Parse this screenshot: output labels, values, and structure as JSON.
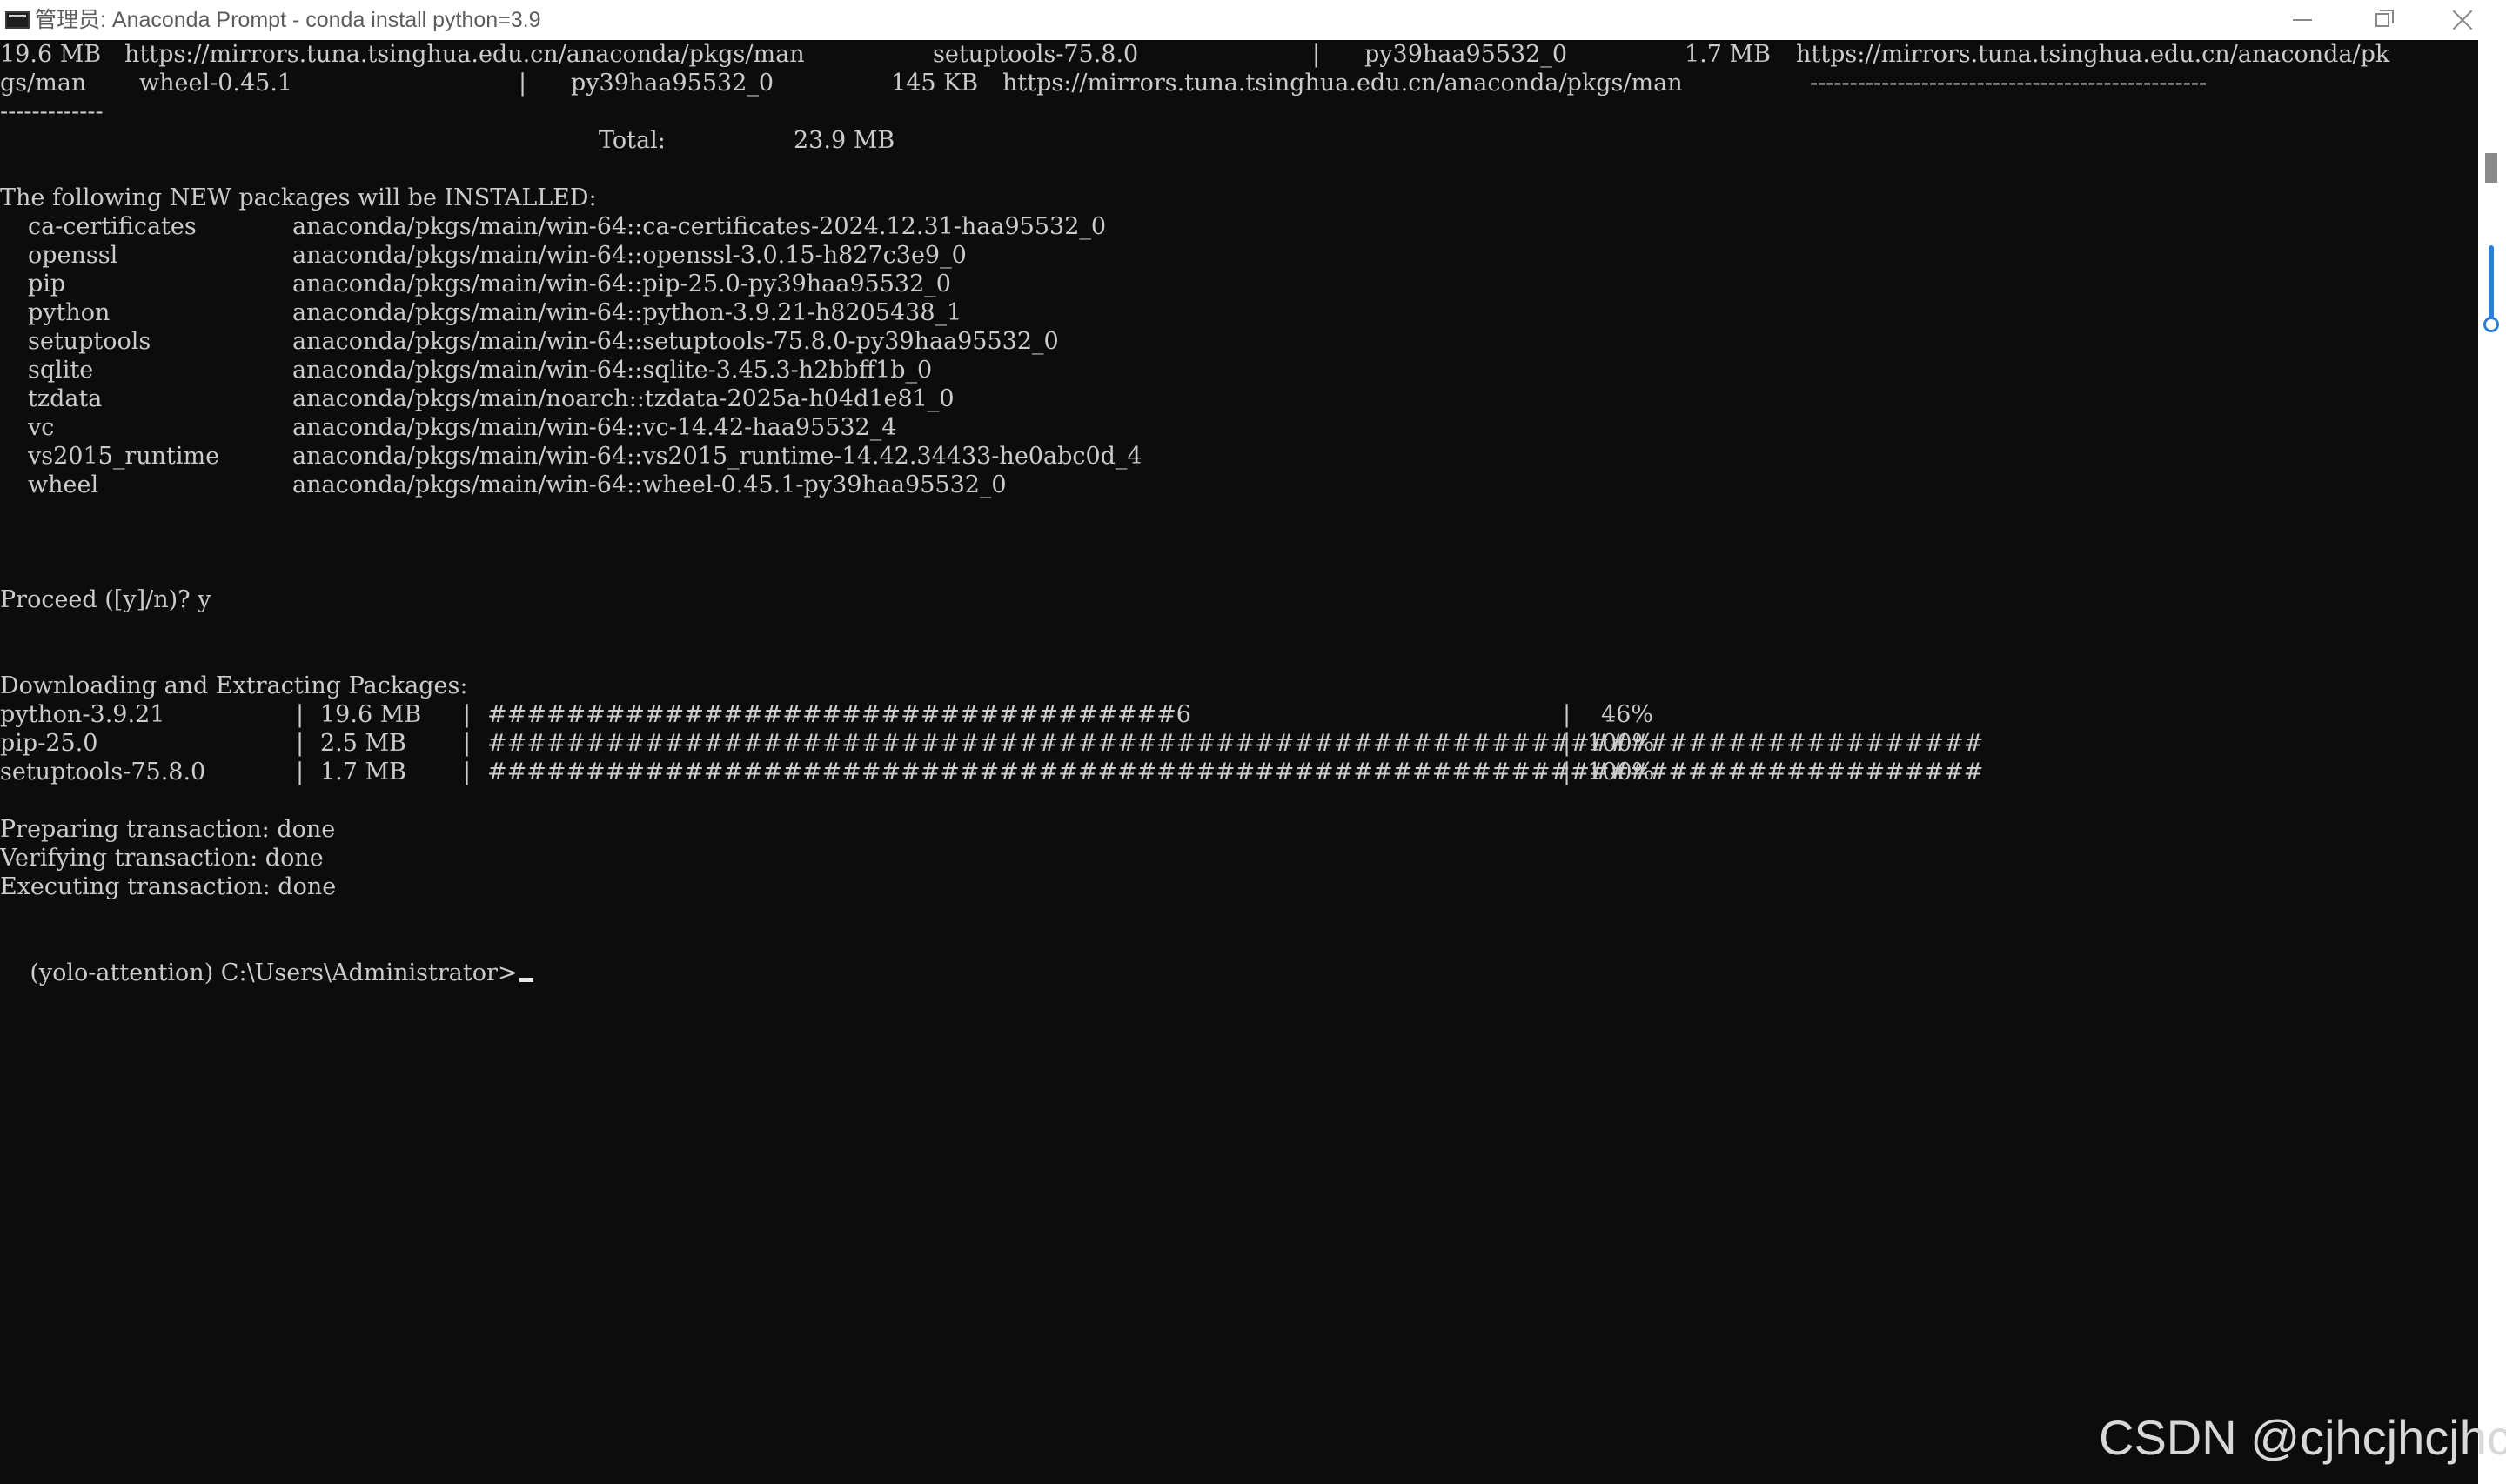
{
  "window": {
    "title": "管理员: Anaconda Prompt - conda  install python=3.9"
  },
  "console": {
    "header_row1": {
      "size1": "19.6 MB",
      "url1": "https://mirrors.tuna.tsinghua.edu.cn/anaconda/pkgs/man",
      "pkg": "setuptools-75.8.0",
      "sep": "|",
      "build": "py39haa95532_0",
      "size2": "1.7 MB",
      "url2": "https://mirrors.tuna.tsinghua.edu.cn/anaconda/pk"
    },
    "header_row2": {
      "a": "gs/man",
      "pkg": "wheel-0.45.1",
      "sep": "|",
      "build": "py39haa95532_0",
      "size": "145 KB",
      "url": "https://mirrors.tuna.tsinghua.edu.cn/anaconda/pkgs/man",
      "dashes": "--------------------------------------------------"
    },
    "header_row3": "-------------",
    "total_label": "Total:",
    "total_value": "23.9 MB",
    "new_packages_heading": "The following NEW packages will be INSTALLED:",
    "packages": [
      {
        "name": "ca-certificates",
        "spec": "anaconda/pkgs/main/win-64::ca-certificates-2024.12.31-haa95532_0"
      },
      {
        "name": "openssl",
        "spec": "anaconda/pkgs/main/win-64::openssl-3.0.15-h827c3e9_0"
      },
      {
        "name": "pip",
        "spec": "anaconda/pkgs/main/win-64::pip-25.0-py39haa95532_0"
      },
      {
        "name": "python",
        "spec": "anaconda/pkgs/main/win-64::python-3.9.21-h8205438_1"
      },
      {
        "name": "setuptools",
        "spec": "anaconda/pkgs/main/win-64::setuptools-75.8.0-py39haa95532_0"
      },
      {
        "name": "sqlite",
        "spec": "anaconda/pkgs/main/win-64::sqlite-3.45.3-h2bbff1b_0"
      },
      {
        "name": "tzdata",
        "spec": "anaconda/pkgs/main/noarch::tzdata-2025a-h04d1e81_0"
      },
      {
        "name": "vc",
        "spec": "anaconda/pkgs/main/win-64::vc-14.42-haa95532_4"
      },
      {
        "name": "vs2015_runtime",
        "spec": "anaconda/pkgs/main/win-64::vs2015_runtime-14.42.34433-he0abc0d_4"
      },
      {
        "name": "wheel",
        "spec": "anaconda/pkgs/main/win-64::wheel-0.45.1-py39haa95532_0"
      }
    ],
    "proceed": "Proceed ([y]/n)? y",
    "download_heading": "Downloading and Extracting Packages:",
    "downloads": [
      {
        "pkg": "python-3.9.21",
        "size": "19.6 MB",
        "bar": "###################################6",
        "pct": "46%"
      },
      {
        "pkg": "pip-25.0",
        "size": "2.5 MB",
        "bar": "############################################################################",
        "pct": "100%"
      },
      {
        "pkg": "setuptools-75.8.0",
        "size": "1.7 MB",
        "bar": "############################################################################",
        "pct": "100%"
      }
    ],
    "bar_sep": "|",
    "preparing": "Preparing transaction: done",
    "verifying": "Verifying transaction: done",
    "executing": "Executing transaction: done",
    "prompt": "(yolo-attention) C:\\Users\\Administrator>"
  },
  "watermark": "CSDN @cjhcjhcjhcj"
}
